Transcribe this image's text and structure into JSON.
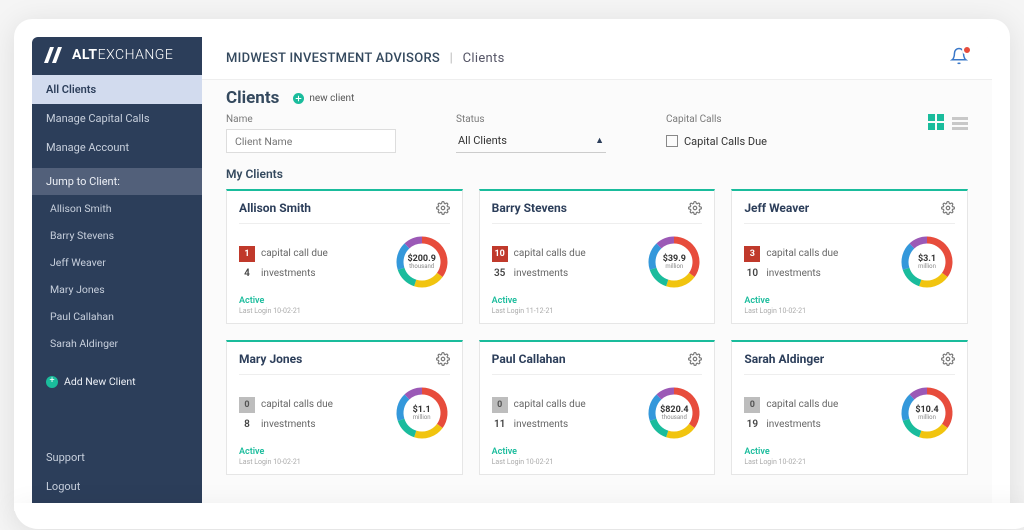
{
  "brand": {
    "bold": "ALT",
    "light": "EXCHANGE"
  },
  "sidebar": {
    "nav": [
      "All Clients",
      "Manage Capital Calls",
      "Manage Account"
    ],
    "jump_label": "Jump to Client:",
    "clients": [
      "Allison Smith",
      "Barry Stevens",
      "Jeff Weaver",
      "Mary Jones",
      "Paul Callahan",
      "Sarah Aldinger"
    ],
    "add_label": "Add New Client",
    "bottom": [
      "Support",
      "Logout"
    ]
  },
  "breadcrumb": {
    "company": "MIDWEST INVESTMENT ADVISORS",
    "page": "Clients"
  },
  "page": {
    "title": "Clients",
    "new_client": "new client",
    "filters": {
      "name_label": "Name",
      "name_placeholder": "Client Name",
      "status_label": "Status",
      "status_value": "All Clients",
      "calls_label": "Capital Calls",
      "calls_check": "Capital Calls Due"
    },
    "section": "My Clients"
  },
  "cards": [
    {
      "name": "Allison Smith",
      "calls": 1,
      "calls_badge": "red",
      "calls_text": "capital call due",
      "inv": 4,
      "inv_text": "investments",
      "amount": "$200.9",
      "unit": "thousand",
      "status": "Active",
      "login": "Last Login 10-02-21"
    },
    {
      "name": "Barry Stevens",
      "calls": 10,
      "calls_badge": "red",
      "calls_text": "capital calls due",
      "inv": 35,
      "inv_text": "investments",
      "amount": "$39.9",
      "unit": "million",
      "status": "Active",
      "login": "Last Login 11-12-21"
    },
    {
      "name": "Jeff Weaver",
      "calls": 3,
      "calls_badge": "red",
      "calls_text": "capital calls due",
      "inv": 10,
      "inv_text": "investments",
      "amount": "$3.1",
      "unit": "million",
      "status": "Active",
      "login": "Last Login 10-02-21"
    },
    {
      "name": "Mary Jones",
      "calls": 0,
      "calls_badge": "grey",
      "calls_text": "capital calls due",
      "inv": 8,
      "inv_text": "investments",
      "amount": "$1.1",
      "unit": "million",
      "status": "Active",
      "login": "Last Login 10-02-21"
    },
    {
      "name": "Paul Callahan",
      "calls": 0,
      "calls_badge": "grey",
      "calls_text": "capital calls due",
      "inv": 11,
      "inv_text": "investments",
      "amount": "$820.4",
      "unit": "thousand",
      "status": "Active",
      "login": "Last Login 10-02-21"
    },
    {
      "name": "Sarah Aldinger",
      "calls": 0,
      "calls_badge": "grey",
      "calls_text": "capital calls due",
      "inv": 19,
      "inv_text": "investments",
      "amount": "$10.4",
      "unit": "million",
      "status": "Active",
      "login": "Last Login 10-02-21"
    }
  ],
  "colors": {
    "donut": [
      "#e74c3c",
      "#f1c40f",
      "#1abc9c",
      "#3498db",
      "#9b59b6"
    ]
  }
}
